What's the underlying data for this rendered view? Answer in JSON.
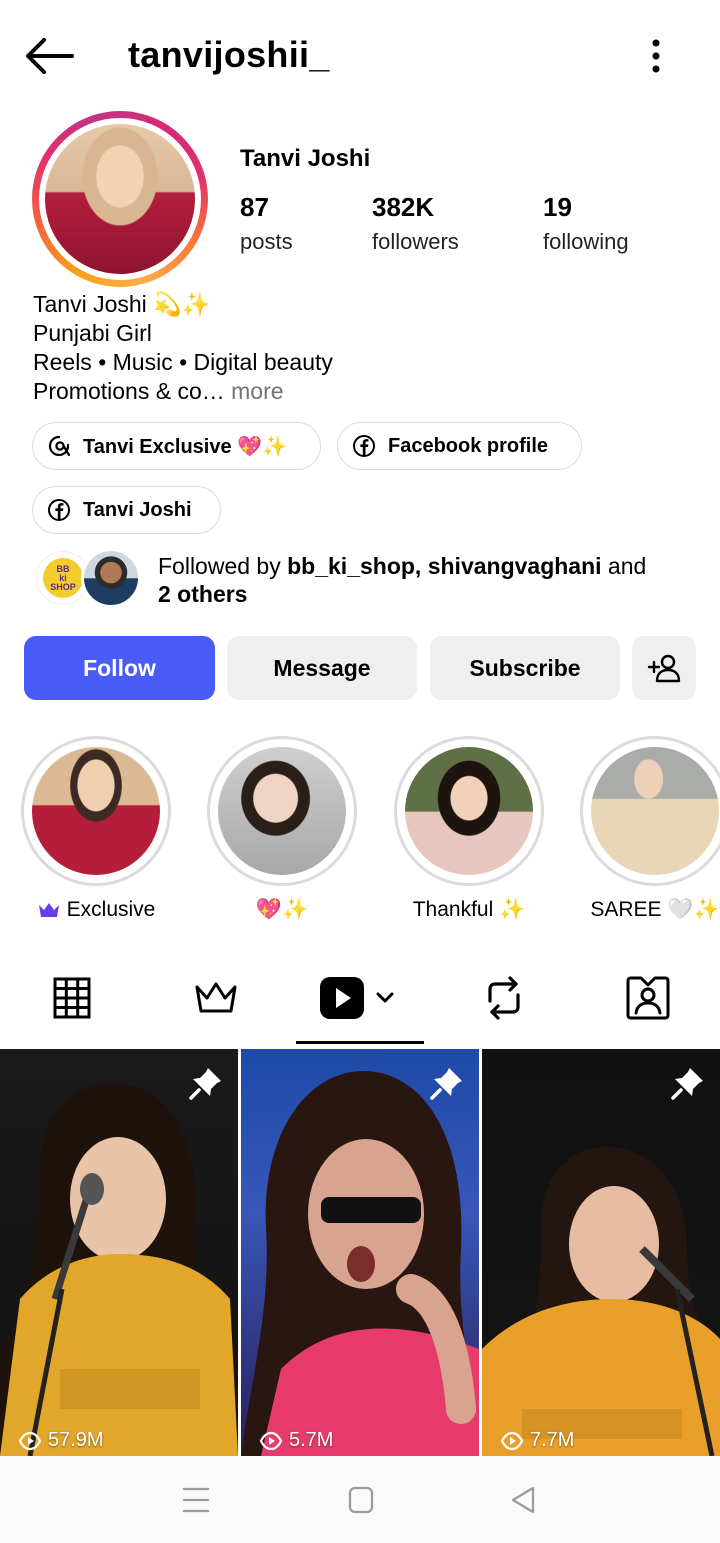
{
  "header": {
    "handle": "tanvijoshii_"
  },
  "profile": {
    "display_name": "Tanvi Joshi",
    "stats": [
      {
        "value": "87",
        "label": "posts"
      },
      {
        "value": "382K",
        "label": "followers"
      },
      {
        "value": "19",
        "label": "following"
      }
    ],
    "bio": {
      "line1": "Tanvi Joshi 💫✨",
      "line2": "Punjabi Girl",
      "line3": "Reels • Music • Digital beauty",
      "line4": "Promotions & co…",
      "more": " more"
    }
  },
  "links": [
    {
      "label": "Tanvi Exclusive 💖✨",
      "icon": "threads-icon"
    },
    {
      "label": "Facebook profile",
      "icon": "facebook-icon"
    },
    {
      "label": "Tanvi Joshi",
      "icon": "facebook-icon"
    }
  ],
  "followed_by": {
    "prefix": "Followed by ",
    "names": "bb_ki_shop, shivangvaghani",
    "and": " and",
    "others": "2 others",
    "logo_text": "BB ki SHOP"
  },
  "actions": {
    "follow": "Follow",
    "message": "Message",
    "subscribe": "Subscribe"
  },
  "highlights": [
    {
      "label": "Exclusive",
      "icon": "crown-icon"
    },
    {
      "label": "💖✨"
    },
    {
      "label": "Thankful ✨"
    },
    {
      "label": "SAREE 🤍✨"
    }
  ],
  "tabs": [
    "grid-icon",
    "crown-icon",
    "reels-icon",
    "repost-icon",
    "tagged-icon"
  ],
  "reels": [
    {
      "views": "57.9M",
      "pinned": true
    },
    {
      "views": "5.7M",
      "pinned": true
    },
    {
      "views": "7.7M",
      "pinned": true
    }
  ],
  "colors": {
    "follow_button": "#4a5cf7",
    "secondary_button": "#efefef"
  }
}
